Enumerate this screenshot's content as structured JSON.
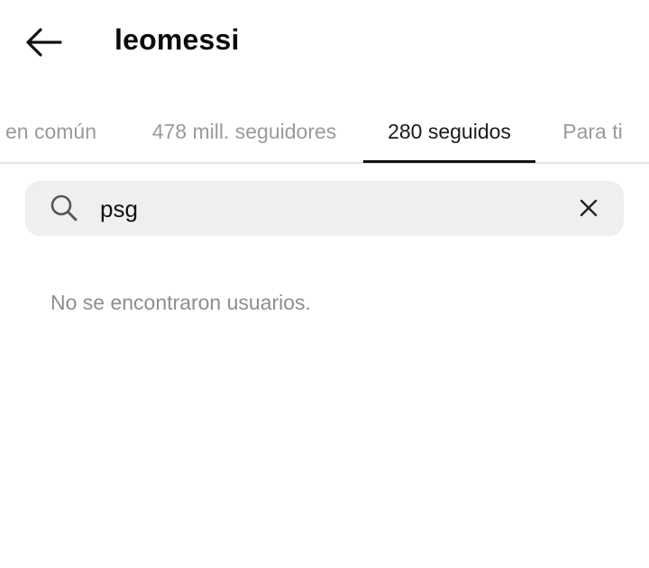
{
  "header": {
    "title": "leomessi",
    "back_icon": "arrow-left-icon"
  },
  "tabs": [
    {
      "label": "en común",
      "active": false
    },
    {
      "label": "478 mill. seguidores",
      "active": false
    },
    {
      "label": "280 seguidos",
      "active": true
    },
    {
      "label": "Para ti",
      "active": false
    }
  ],
  "search": {
    "value": "psg",
    "search_icon": "search-icon",
    "clear_icon": "close-icon"
  },
  "results": {
    "empty_message": "No se encontraron usuarios."
  },
  "colors": {
    "background": "#ffffff",
    "search_bg": "#efefef",
    "inactive_text": "#9a9a9a",
    "active_text": "#1a1a1a"
  }
}
